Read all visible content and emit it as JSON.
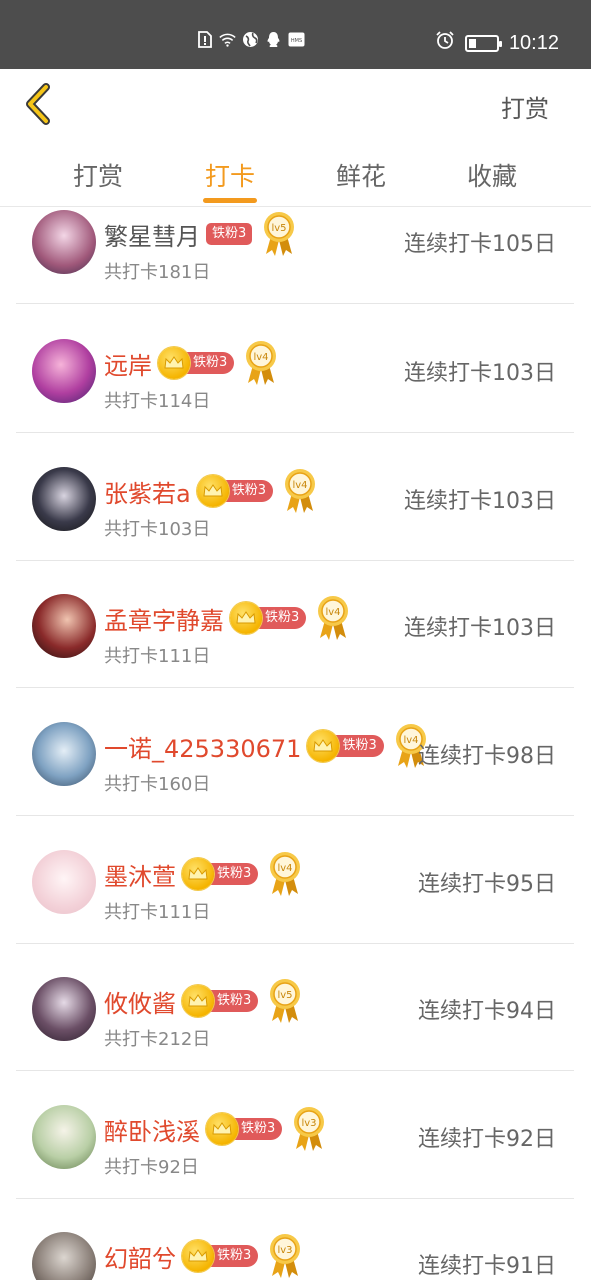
{
  "status_bar": {
    "time": "10:12",
    "icons": [
      "sim-alert-icon",
      "wifi-icon",
      "globe-icon",
      "qq-icon",
      "hms-icon",
      "alarm-icon",
      "battery-icon"
    ],
    "battery_level": 0.25
  },
  "header": {
    "back_icon": "chevron-left-icon",
    "action_label": "打赏"
  },
  "tabs": [
    {
      "label": "打赏",
      "active": false
    },
    {
      "label": "打卡",
      "active": true
    },
    {
      "label": "鲜花",
      "active": false
    },
    {
      "label": "收藏",
      "active": false
    }
  ],
  "colors": {
    "accent": "#f39a1e",
    "username": "#e0492d",
    "fan_badge": "#e05a5a",
    "medal_gold": "#f5b400"
  },
  "rows": [
    {
      "name": "繁星彗月",
      "fan_badge": "铁粉3",
      "has_crown": false,
      "level": "lv5",
      "total": "共打卡181日",
      "streak": "连续打卡105日"
    },
    {
      "name": "远岸",
      "fan_badge": "铁粉3",
      "has_crown": true,
      "level": "lv4",
      "total": "共打卡114日",
      "streak": "连续打卡103日"
    },
    {
      "name": "张紫若a",
      "fan_badge": "铁粉3",
      "has_crown": true,
      "level": "lv4",
      "total": "共打卡103日",
      "streak": "连续打卡103日"
    },
    {
      "name": "孟章字静嘉",
      "fan_badge": "铁粉3",
      "has_crown": true,
      "level": "lv4",
      "total": "共打卡111日",
      "streak": "连续打卡103日"
    },
    {
      "name": "一诺_425330671",
      "fan_badge": "铁粉3",
      "has_crown": true,
      "level": "lv4",
      "total": "共打卡160日",
      "streak": "连续打卡98日"
    },
    {
      "name": "墨沐萱",
      "fan_badge": "铁粉3",
      "has_crown": true,
      "level": "lv4",
      "total": "共打卡111日",
      "streak": "连续打卡95日"
    },
    {
      "name": "攸攸酱",
      "fan_badge": "铁粉3",
      "has_crown": true,
      "level": "lv5",
      "total": "共打卡212日",
      "streak": "连续打卡94日"
    },
    {
      "name": "醉卧浅溪",
      "fan_badge": "铁粉3",
      "has_crown": true,
      "level": "lv3",
      "total": "共打卡92日",
      "streak": "连续打卡92日"
    },
    {
      "name": "幻韶兮",
      "fan_badge": "铁粉3",
      "has_crown": true,
      "level": "lv3",
      "total": "",
      "streak": "连续打卡91日"
    }
  ]
}
